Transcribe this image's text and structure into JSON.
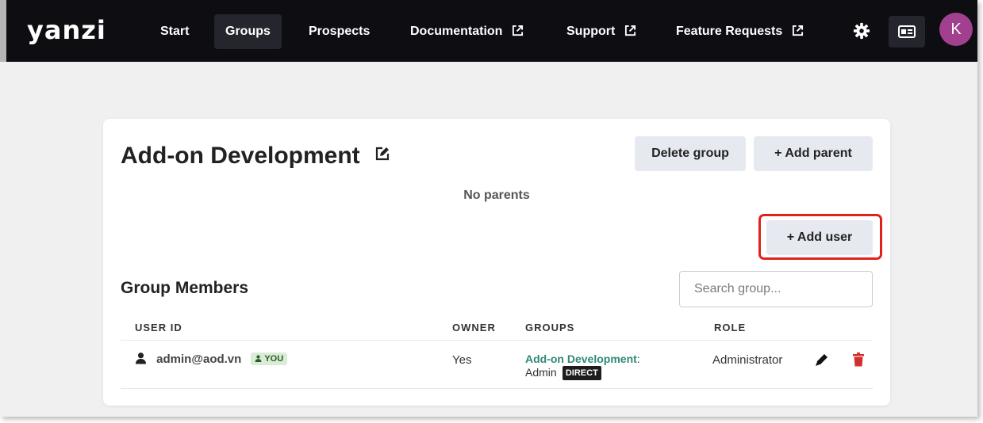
{
  "brand": {
    "logo_text": "yanzi"
  },
  "nav": {
    "items": [
      {
        "label": "Start",
        "active": false,
        "external": false
      },
      {
        "label": "Groups",
        "active": true,
        "external": false
      },
      {
        "label": "Prospects",
        "active": false,
        "external": false
      },
      {
        "label": "Documentation",
        "active": false,
        "external": true
      },
      {
        "label": "Support",
        "active": false,
        "external": true
      },
      {
        "label": "Feature Requests",
        "active": false,
        "external": true
      }
    ],
    "icons": [
      "gear-icon",
      "id-card-icon"
    ],
    "avatar_initial": "K",
    "avatar_color": "#a0408e"
  },
  "group": {
    "title": "Add-on Development",
    "delete_label": "Delete group",
    "add_parent_label": "+ Add parent",
    "no_parents_text": "No parents",
    "add_user_label": "+ Add user"
  },
  "members": {
    "section_title": "Group Members",
    "search_placeholder": "Search group...",
    "columns": [
      "USER ID",
      "OWNER",
      "GROUPS",
      "ROLE"
    ],
    "rows": [
      {
        "user_id": "admin@aod.vn",
        "you_badge": "YOU",
        "owner": "Yes",
        "group_name": "Add-on Development",
        "group_role": "Admin",
        "membership_badge": "DIRECT",
        "role": "Administrator"
      }
    ]
  },
  "colors": {
    "nav_background": "#0d0d12",
    "highlight_border": "#e2211c",
    "group_link": "#2c8a73",
    "delete_icon": "#d32f2f"
  }
}
